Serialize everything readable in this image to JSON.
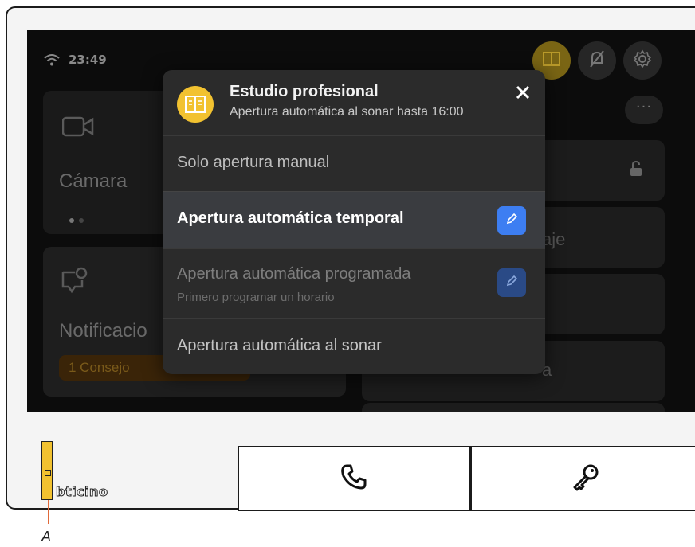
{
  "status": {
    "time": "23:49"
  },
  "background": {
    "camera_label": "Cámara",
    "notifications_label": "Notificacio",
    "notifications_badge": "1 Consejo",
    "tile_text_1": "aje",
    "tile_text_2": "a"
  },
  "popup": {
    "title": "Estudio profesional",
    "subtitle": "Apertura automática al sonar hasta 16:00",
    "options": [
      {
        "label": "Solo apertura manual"
      },
      {
        "label": "Apertura automática temporal"
      },
      {
        "label": "Apertura automática programada",
        "sub": "Primero programar un horario"
      },
      {
        "label": "Apertura automática al sonar"
      }
    ]
  },
  "device": {
    "brand": "bticino",
    "callout": "A"
  },
  "colors": {
    "accent_yellow": "#f2c230",
    "edit_blue": "#3d7ef2",
    "popup_bg": "#2b2b2b"
  },
  "icons": {
    "wifi": "wifi-icon",
    "studio": "studio-icon",
    "bell_off": "bell-off-icon",
    "settings": "gear-icon",
    "close": "close-icon",
    "edit": "pencil-icon",
    "phone": "phone-icon",
    "key": "key-icon"
  }
}
